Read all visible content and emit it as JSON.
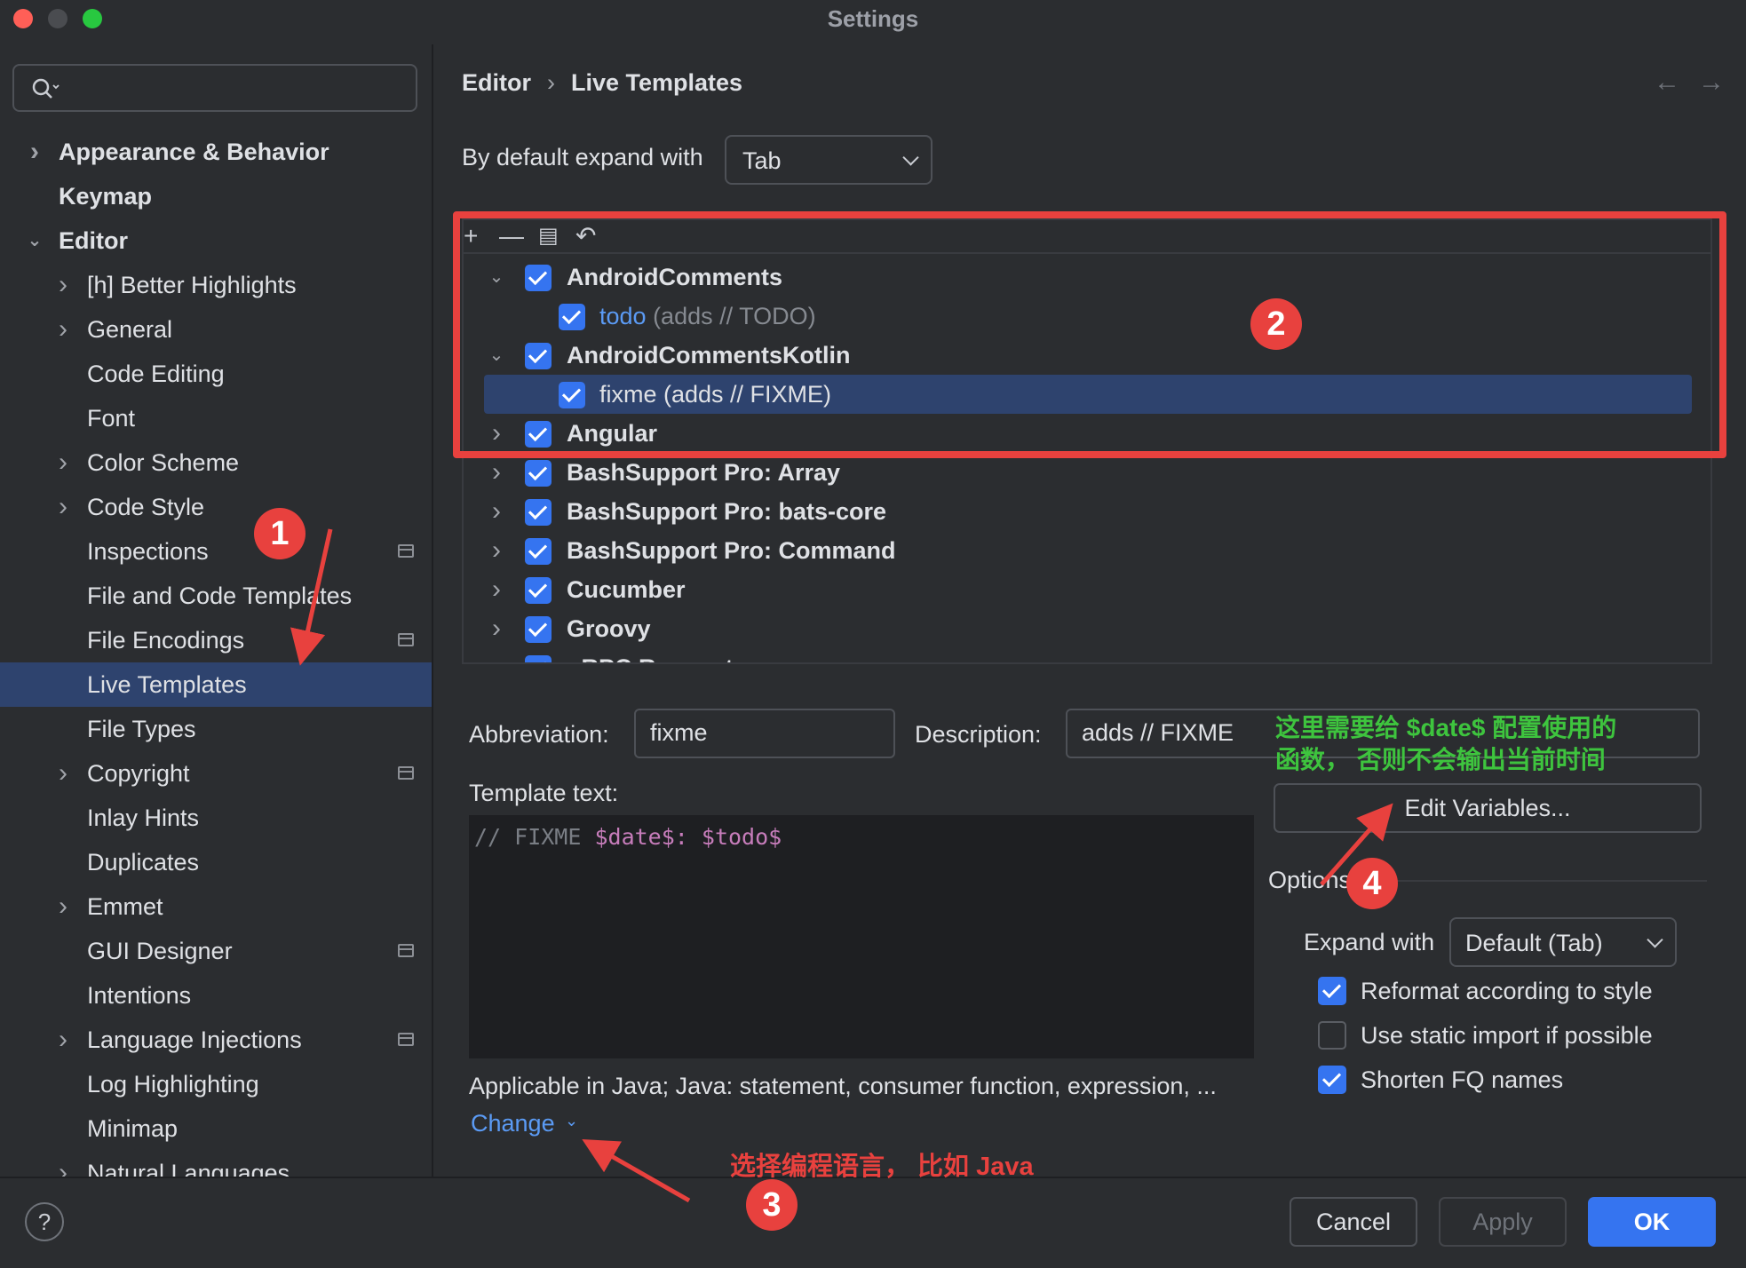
{
  "window": {
    "title": "Settings"
  },
  "search": {
    "placeholder": ""
  },
  "sidebar": {
    "items": [
      {
        "label": "Appearance & Behavior",
        "chevron": "right",
        "level": 0,
        "bold": true
      },
      {
        "label": "Keymap",
        "chevron": "",
        "level": 0,
        "bold": true
      },
      {
        "label": "Editor",
        "chevron": "down",
        "level": 0,
        "bold": true
      },
      {
        "label": "[h] Better Highlights",
        "chevron": "right",
        "level": 1
      },
      {
        "label": "General",
        "chevron": "right",
        "level": 1
      },
      {
        "label": "Code Editing",
        "chevron": "",
        "level": 1
      },
      {
        "label": "Font",
        "chevron": "",
        "level": 1
      },
      {
        "label": "Color Scheme",
        "chevron": "right",
        "level": 1
      },
      {
        "label": "Code Style",
        "chevron": "right",
        "level": 1
      },
      {
        "label": "Inspections",
        "chevron": "",
        "level": 1,
        "project": true
      },
      {
        "label": "File and Code Templates",
        "chevron": "",
        "level": 1
      },
      {
        "label": "File Encodings",
        "chevron": "",
        "level": 1,
        "project": true
      },
      {
        "label": "Live Templates",
        "chevron": "",
        "level": 1,
        "selected": true
      },
      {
        "label": "File Types",
        "chevron": "",
        "level": 1
      },
      {
        "label": "Copyright",
        "chevron": "right",
        "level": 1,
        "project": true
      },
      {
        "label": "Inlay Hints",
        "chevron": "",
        "level": 1
      },
      {
        "label": "Duplicates",
        "chevron": "",
        "level": 1
      },
      {
        "label": "Emmet",
        "chevron": "right",
        "level": 1
      },
      {
        "label": "GUI Designer",
        "chevron": "",
        "level": 1,
        "project": true
      },
      {
        "label": "Intentions",
        "chevron": "",
        "level": 1
      },
      {
        "label": "Language Injections",
        "chevron": "right",
        "level": 1,
        "project": true
      },
      {
        "label": "Log Highlighting",
        "chevron": "",
        "level": 1
      },
      {
        "label": "Minimap",
        "chevron": "",
        "level": 1
      },
      {
        "label": "Natural Languages",
        "chevron": "right",
        "level": 1
      }
    ]
  },
  "breadcrumb": {
    "parent": "Editor",
    "current": "Live Templates",
    "separator": "›"
  },
  "nav": {
    "back": "←",
    "forward": "→"
  },
  "expand_default": {
    "label": "By default expand with",
    "value": "Tab"
  },
  "toolbar": {
    "add": "+",
    "remove": "—",
    "copy": "▤",
    "restore": "↶"
  },
  "templates": [
    {
      "name": "AndroidComments",
      "chevron": "down",
      "checked": true,
      "group": true
    },
    {
      "name": "todo",
      "desc": " (adds // TODO)",
      "checked": true,
      "group": false
    },
    {
      "name": "AndroidCommentsKotlin",
      "chevron": "down",
      "checked": true,
      "group": true
    },
    {
      "name": "fixme (adds // FIXME)",
      "checked": true,
      "group": false,
      "selected": true
    },
    {
      "name": "Angular",
      "chevron": "right",
      "checked": true,
      "group": true
    },
    {
      "name": "BashSupport Pro: Array",
      "chevron": "right",
      "checked": true,
      "group": true
    },
    {
      "name": "BashSupport Pro: bats-core",
      "chevron": "right",
      "checked": true,
      "group": true
    },
    {
      "name": "BashSupport Pro: Command",
      "chevron": "right",
      "checked": true,
      "group": true
    },
    {
      "name": "Cucumber",
      "chevron": "right",
      "checked": true,
      "group": true
    },
    {
      "name": "Groovy",
      "chevron": "right",
      "checked": true,
      "group": true
    },
    {
      "name": "gRPC Request",
      "chevron": "right",
      "checked": true,
      "group": true
    }
  ],
  "form": {
    "abbreviation_label": "Abbreviation:",
    "abbreviation_value": "fixme",
    "description_label": "Description:",
    "description_value": "adds // FIXME",
    "template_text_label": "Template text:",
    "template_text": {
      "comment": "// FIXME ",
      "var1": "$date$",
      "colon": ": ",
      "var2": "$todo$"
    },
    "applicable": "Applicable in Java; Java: statement, consumer function, expression, ...",
    "change_link": "Change",
    "edit_variables": "Edit Variables..."
  },
  "options": {
    "title": "Options",
    "expand_with_label": "Expand with",
    "expand_with_value": "Default (Tab)",
    "items": [
      {
        "label": "Reformat according to style",
        "checked": true
      },
      {
        "label": "Use static import if possible",
        "checked": false
      },
      {
        "label": "Shorten FQ names",
        "checked": true
      }
    ]
  },
  "footer": {
    "help": "?",
    "cancel": "Cancel",
    "apply": "Apply",
    "ok": "OK"
  },
  "annotations": {
    "badge1": "1",
    "badge2": "2",
    "badge3": "3",
    "badge4": "4",
    "note_green_line1": "这里需要给 $date$ 配置使用的",
    "note_green_line2": "函数， 否则不会输出当前时间",
    "note_red": "选择编程语言， 比如 Java"
  },
  "colors": {
    "accent": "#3574f0",
    "annotation_red": "#e8413e",
    "annotation_green": "#3ec43e",
    "selection": "#2e436e"
  }
}
